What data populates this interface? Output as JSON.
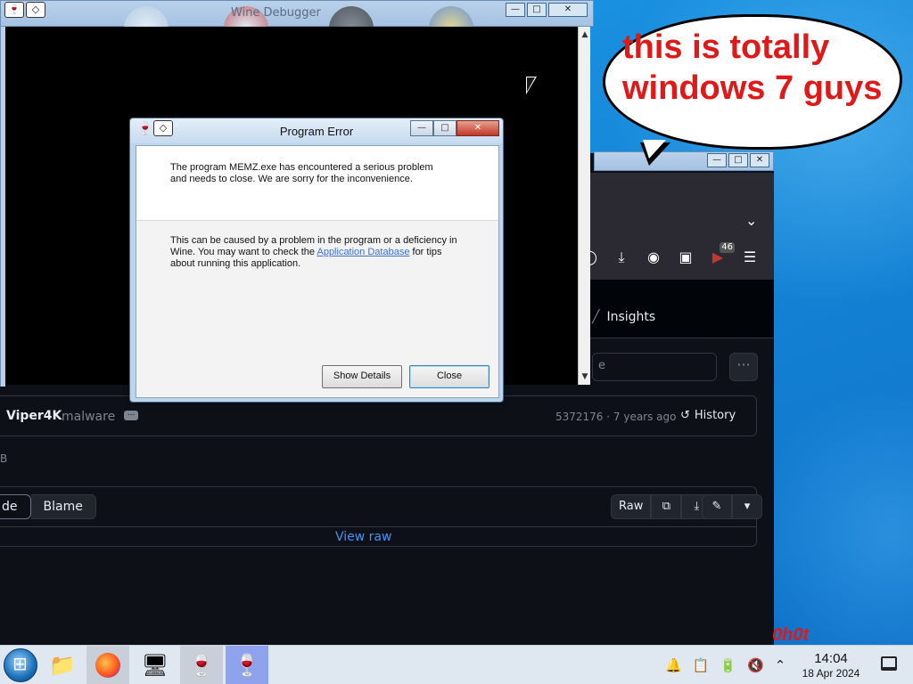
{
  "bubble": {
    "text": "this is totally windows 7 guys"
  },
  "wine_debugger": {
    "title": "Wine Debugger"
  },
  "dialog": {
    "title": "Program Error",
    "message": "The program MEMZ.exe has encountered a serious problem and needs to close. We are sorry for the inconvenience.",
    "hint_before": "This can be caused by a problem in the program or a deficiency in Wine. You may want to check the ",
    "hint_link": "Application Database",
    "hint_after": " for tips about running this application.",
    "show_details_label": "Show Details",
    "close_label": "Close"
  },
  "browser": {
    "insights_label": "Insights",
    "search_placeholder": "e",
    "downloads_badge": "46",
    "commit": {
      "user": "Viper4K",
      "message": "malware",
      "meta": "5372176 · 7 years ago",
      "history_label": "History"
    },
    "size_text": "B",
    "code_tab": "de",
    "blame_tab": "Blame",
    "raw_label": "Raw",
    "view_raw_label": "View raw"
  },
  "corner_text": "0h0t",
  "taskbar": {
    "time": "14:04",
    "date": "18 Apr 2024"
  },
  "colors": {
    "accent": "#4493f8",
    "bubble_text": "#e01818"
  }
}
